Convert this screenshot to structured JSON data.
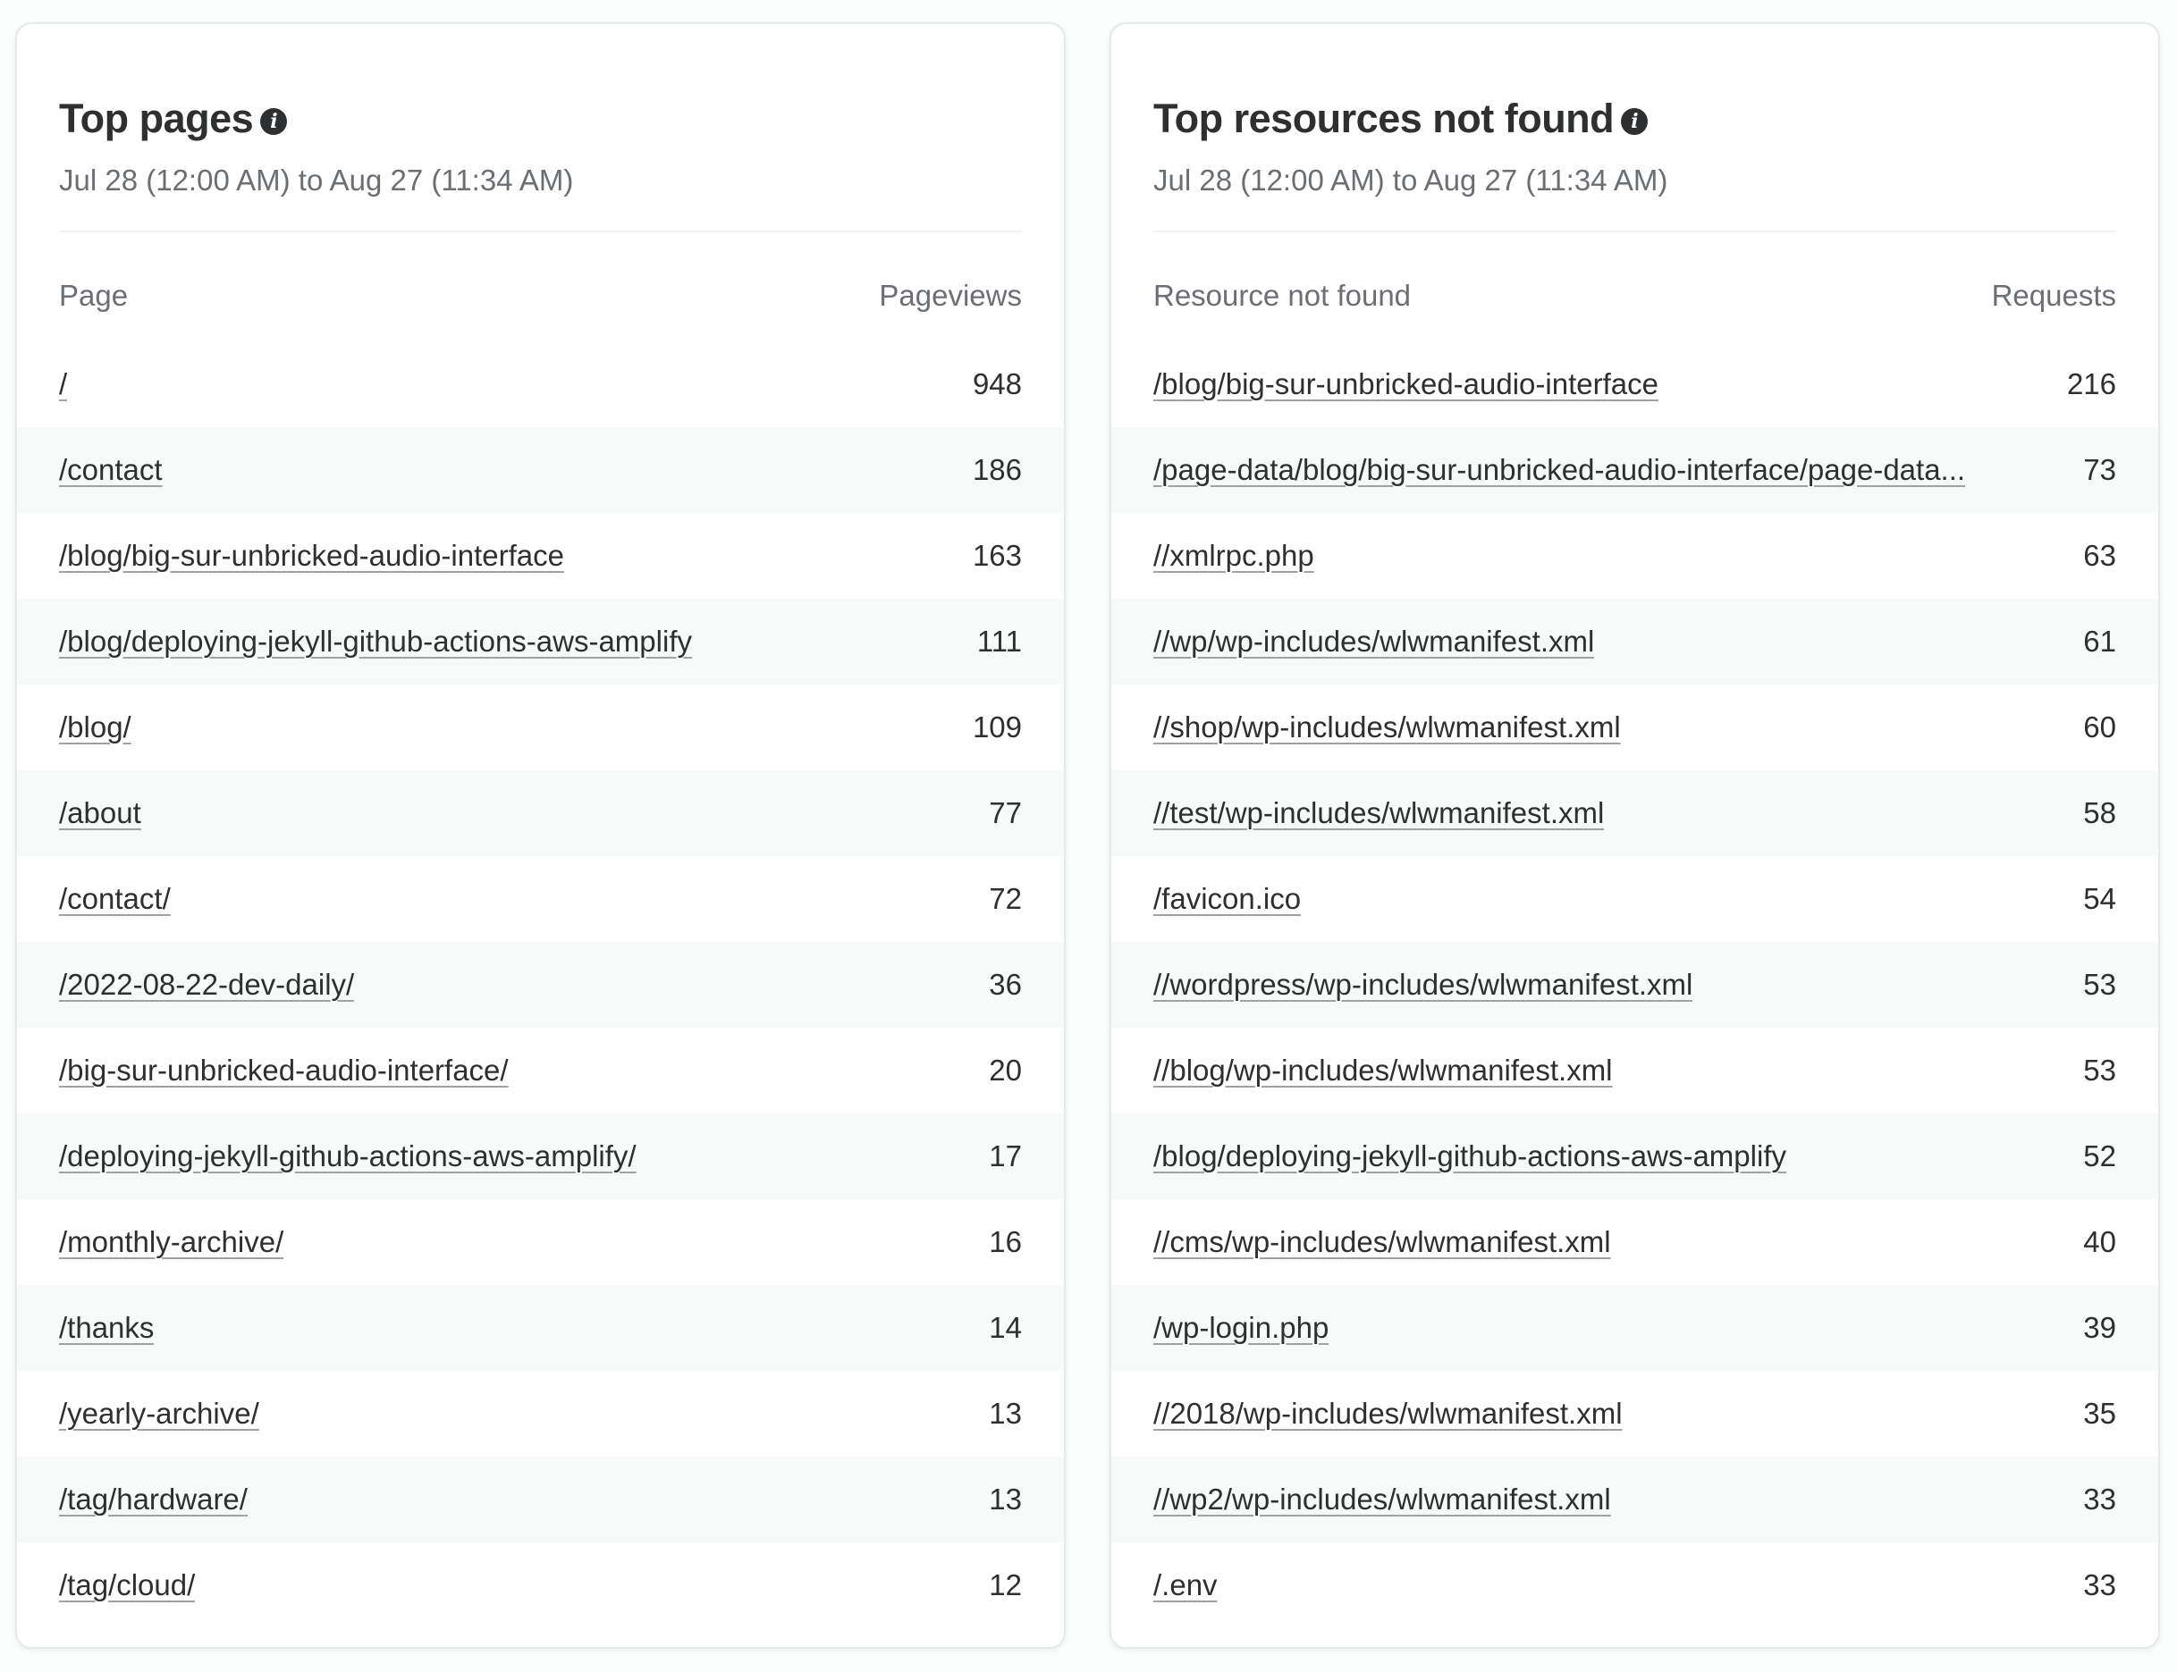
{
  "top_pages": {
    "title": "Top pages",
    "info_icon": "info-circle-icon",
    "date_range": "Jul 28 (12:00 AM) to Aug 27 (11:34 AM)",
    "columns": [
      "Page",
      "Pageviews"
    ],
    "rows": [
      {
        "label": "/",
        "value": "948"
      },
      {
        "label": "/contact",
        "value": "186"
      },
      {
        "label": "/blog/big-sur-unbricked-audio-interface",
        "value": "163"
      },
      {
        "label": "/blog/deploying-jekyll-github-actions-aws-amplify",
        "value": "111"
      },
      {
        "label": "/blog/",
        "value": "109"
      },
      {
        "label": "/about",
        "value": "77"
      },
      {
        "label": "/contact/",
        "value": "72"
      },
      {
        "label": "/2022-08-22-dev-daily/",
        "value": "36"
      },
      {
        "label": "/big-sur-unbricked-audio-interface/",
        "value": "20"
      },
      {
        "label": "/deploying-jekyll-github-actions-aws-amplify/",
        "value": "17"
      },
      {
        "label": "/monthly-archive/",
        "value": "16"
      },
      {
        "label": "/thanks",
        "value": "14"
      },
      {
        "label": "/yearly-archive/",
        "value": "13"
      },
      {
        "label": "/tag/hardware/",
        "value": "13"
      },
      {
        "label": "/tag/cloud/",
        "value": "12"
      }
    ]
  },
  "top_not_found": {
    "title": "Top resources not found",
    "info_icon": "info-circle-icon",
    "date_range": "Jul 28 (12:00 AM) to Aug 27 (11:34 AM)",
    "columns": [
      "Resource not found",
      "Requests"
    ],
    "rows": [
      {
        "label": "/blog/big-sur-unbricked-audio-interface",
        "value": "216"
      },
      {
        "label": "/page-data/blog/big-sur-unbricked-audio-interface/page-data...",
        "value": "73"
      },
      {
        "label": "//xmlrpc.php",
        "value": "63"
      },
      {
        "label": "//wp/wp-includes/wlwmanifest.xml",
        "value": "61"
      },
      {
        "label": "//shop/wp-includes/wlwmanifest.xml",
        "value": "60"
      },
      {
        "label": "//test/wp-includes/wlwmanifest.xml",
        "value": "58"
      },
      {
        "label": "/favicon.ico",
        "value": "54"
      },
      {
        "label": "//wordpress/wp-includes/wlwmanifest.xml",
        "value": "53"
      },
      {
        "label": "//blog/wp-includes/wlwmanifest.xml",
        "value": "53"
      },
      {
        "label": "/blog/deploying-jekyll-github-actions-aws-amplify",
        "value": "52"
      },
      {
        "label": "//cms/wp-includes/wlwmanifest.xml",
        "value": "40"
      },
      {
        "label": "/wp-login.php",
        "value": "39"
      },
      {
        "label": "//2018/wp-includes/wlwmanifest.xml",
        "value": "35"
      },
      {
        "label": "//wp2/wp-includes/wlwmanifest.xml",
        "value": "33"
      },
      {
        "label": "/.env",
        "value": "33"
      }
    ]
  }
}
